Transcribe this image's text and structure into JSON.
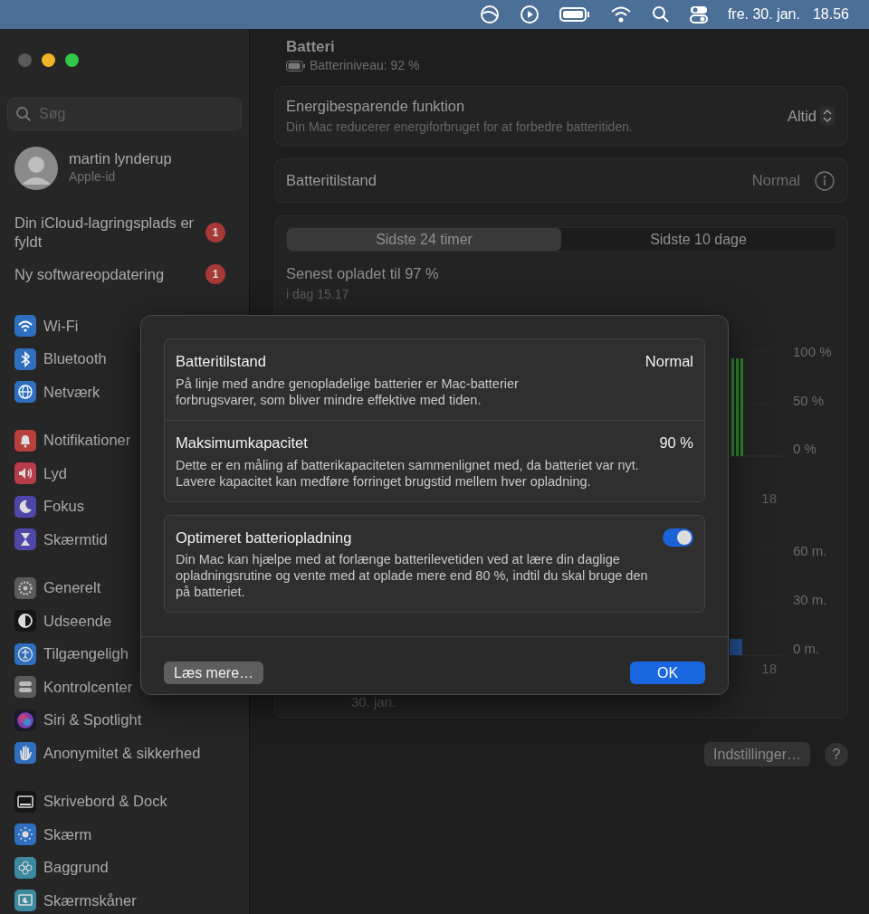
{
  "menu_bar": {
    "date": "fre. 30. jan.",
    "time": "18.56"
  },
  "sidebar": {
    "search": {
      "placeholder": "Søg"
    },
    "account": {
      "name": "martin lynderup",
      "subtitle": "Apple-id"
    },
    "alerts": [
      {
        "label": "Din iCloud-lagringsplads er fyldt",
        "badge": "1"
      },
      {
        "label": "Ny softwareopdatering",
        "badge": "1"
      }
    ],
    "groups": [
      {
        "items": [
          {
            "label": "Wi-Fi"
          },
          {
            "label": "Bluetooth"
          },
          {
            "label": "Netværk"
          }
        ]
      },
      {
        "items": [
          {
            "label": "Notifikationer"
          },
          {
            "label": "Lyd"
          },
          {
            "label": "Fokus"
          },
          {
            "label": "Skærmtid"
          }
        ]
      },
      {
        "items": [
          {
            "label": "Generelt"
          },
          {
            "label": "Udseende"
          },
          {
            "label": "Tilgængeligh"
          },
          {
            "label": "Kontrolcenter"
          },
          {
            "label": "Siri & Spotlight"
          },
          {
            "label": "Anonymitet & sikkerhed"
          }
        ]
      },
      {
        "items": [
          {
            "label": "Skrivebord & Dock"
          },
          {
            "label": "Skærm"
          },
          {
            "label": "Baggrund"
          },
          {
            "label": "Skærmskåner"
          }
        ]
      }
    ]
  },
  "header": {
    "title": "Batteri",
    "battery_level": "Batteriniveau: 92 %"
  },
  "settings": [
    {
      "kind": "popup",
      "label": "Energibesparende funktion",
      "description": "Din Mac reducerer energiforbruget for at forbedre batteritiden.",
      "value": "Altid"
    },
    {
      "kind": "info",
      "label": "Batteritilstand",
      "value": "Normal"
    }
  ],
  "usage": {
    "tabs": [
      {
        "label": "Sidste 24 timer",
        "selected": true
      },
      {
        "label": "Sidste 10 dage",
        "selected": false
      }
    ],
    "last_charged": "Senest opladet til 97 %",
    "last_charged_time": "i dag 15.17",
    "level_axis": [
      "100 %",
      "50 %",
      "0 %"
    ],
    "level_x_label": "18",
    "time_axis": [
      "60 m.",
      "30 m.",
      "0 m."
    ],
    "time_x_label": "18",
    "date_label": "30. jan."
  },
  "footer_buttons": [
    {
      "kind": "text",
      "label": "Indstillinger…"
    },
    {
      "kind": "help",
      "label": "?"
    }
  ],
  "dialog": {
    "sections": [
      {
        "title": "Batteritilstand",
        "value": "Normal",
        "description": "På linje med andre genopladelige batterier er Mac-batterier forbrugsvarer, som bliver mindre effektive med tiden."
      },
      {
        "title": "Maksimumkapacitet",
        "value": "90 %",
        "description": "Dette er en måling af batterikapaciteten sammenlignet med, da batteriet var nyt. Lavere kapacitet kan medføre forringet brugstid mellem hver opladning."
      }
    ],
    "option": {
      "title": "Optimeret batteriopladning",
      "description": "Din Mac kan hjælpe med at forlænge batterilevetiden ved at lære din daglige opladningsrutine og vente med at oplade mere end 80 %, indtil du skal bruge den på batteriet.",
      "on": true
    },
    "buttons": [
      {
        "kind": "secondary",
        "label": "Læs mere…"
      },
      {
        "kind": "primary",
        "label": "OK"
      }
    ]
  }
}
